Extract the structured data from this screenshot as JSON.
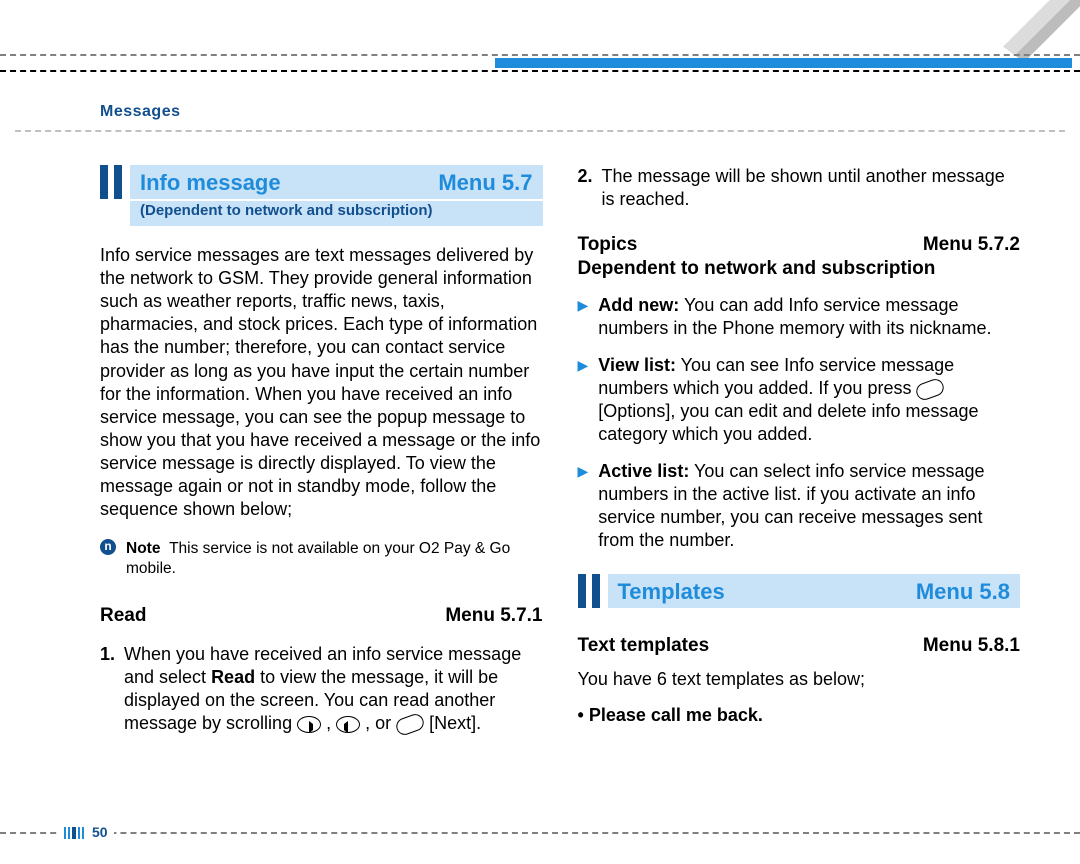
{
  "header": {
    "section_label": "Messages"
  },
  "info_message": {
    "title": "Info message",
    "menu": "Menu 5.7",
    "subtitle": "(Dependent to network and subscription)",
    "body": "Info service messages are text messages delivered by the network to GSM. They provide general information such as weather reports, traffic news, taxis, pharmacies, and stock prices. Each type of information has the number; therefore, you can contact service provider as long as you have input the certain number for the information. When you have received an info service message, you can see the popup message to show you that you have received a message or the info service message is directly displayed. To view the message again or not in standby mode, follow the sequence shown below;",
    "note_label": "Note",
    "note_body": "This service is not available on your O2 Pay & Go mobile."
  },
  "read": {
    "title": "Read",
    "menu": "Menu 5.7.1",
    "step1_a": "When you have received an info service message and select ",
    "step1_bold": "Read",
    "step1_b": " to view the message, it will be displayed on the screen. You can read another message by scrolling ",
    "step1_between1": " , ",
    "step1_between2": " , or ",
    "step1_end": " [Next].",
    "step2": "The message will be shown until another message is reached."
  },
  "topics": {
    "title": "Topics",
    "menu": "Menu 5.7.2",
    "subsub": "Dependent to network and subscription",
    "addnew_label": "Add new:",
    "addnew_text": " You can add Info service message numbers in the Phone memory with its nickname.",
    "viewlist_label": "View list:",
    "viewlist_a": " You can see Info service message numbers which you added. If you press ",
    "viewlist_b": " [Options], you can edit and delete info message category which you added.",
    "activelist_label": "Active list:",
    "activelist_text": " You can select info service message numbers in the active list. if you activate an info service number, you can receive messages sent from the number."
  },
  "templates": {
    "title": "Templates",
    "menu": "Menu 5.8"
  },
  "text_templates": {
    "title": "Text templates",
    "menu": "Menu 5.8.1",
    "intro": "You have 6 text templates as below;",
    "item1": "Please call me back."
  },
  "page_number": "50"
}
